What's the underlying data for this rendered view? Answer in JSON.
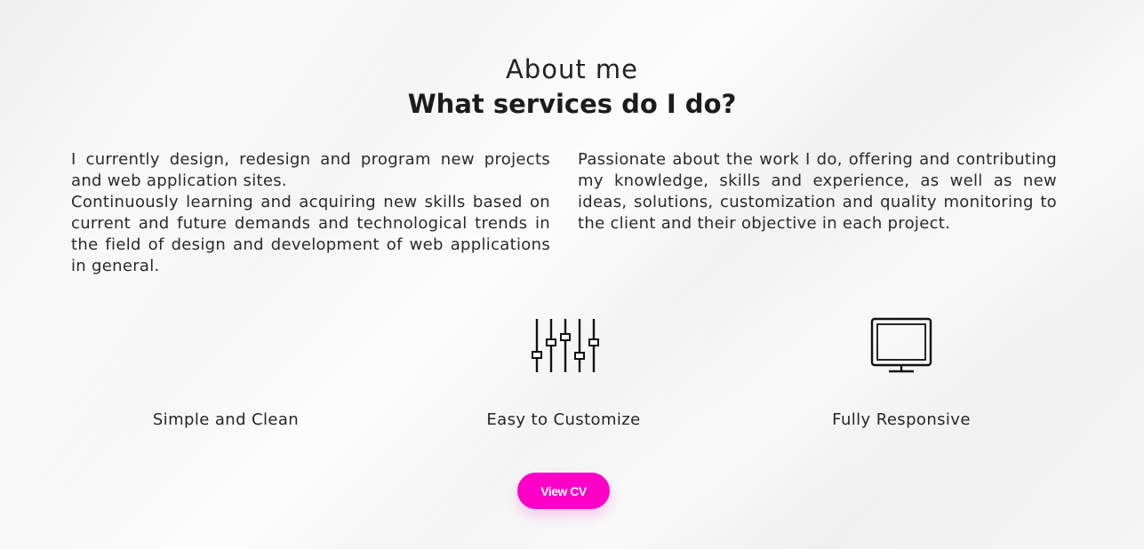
{
  "section": {
    "subtitle": "About me",
    "title": "What services do I do?"
  },
  "about": {
    "left": [
      "I currently design, redesign and program new projects and web application sites.",
      "Continuously learning and acquiring new skills based on current and future demands and technological trends in the field of design and development of web applications in general."
    ],
    "right": [
      "Passionate about the work I do, offering and contributing my knowledge, skills and experience, as well as new ideas, solutions, customization and quality monitoring to the client and their objective in each project."
    ]
  },
  "features": [
    {
      "label": "Simple and Clean",
      "icon": "none"
    },
    {
      "label": "Easy to Customize",
      "icon": "sliders-icon"
    },
    {
      "label": "Fully Responsive",
      "icon": "monitor-icon"
    }
  ],
  "cta": {
    "label": "View CV"
  },
  "colors": {
    "accent": "#ff00c8",
    "text": "#1f1f1f",
    "background": "#f3f3f3"
  }
}
